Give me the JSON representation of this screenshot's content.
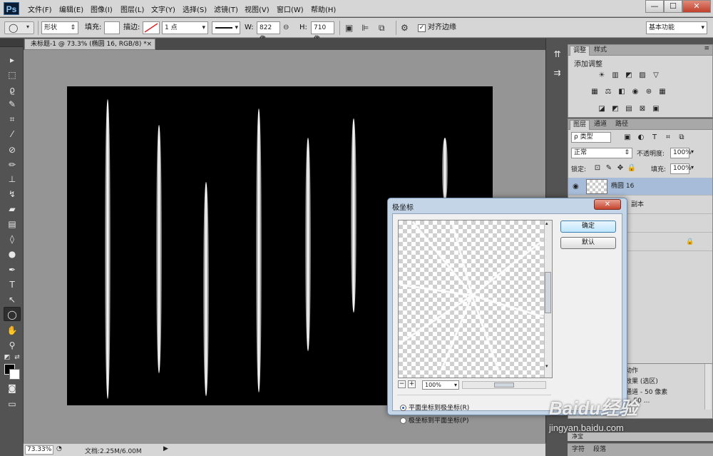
{
  "app": {
    "logo": "Ps",
    "menus": [
      "文件(F)",
      "编辑(E)",
      "图像(I)",
      "图层(L)",
      "文字(Y)",
      "选择(S)",
      "滤镜(T)",
      "视图(V)",
      "窗口(W)",
      "帮助(H)"
    ],
    "window_controls": {
      "minimize": "—",
      "maximize": "☐",
      "close": "✕"
    }
  },
  "options": {
    "mode": "形状",
    "fill_label": "填充:",
    "stroke_label": "描边:",
    "stroke_width": "1 点",
    "w_label": "W:",
    "w_value": "822 像",
    "h_label": "H:",
    "h_value": "710 像",
    "align_edges_label": "对齐边缘",
    "align_edges_checked": true,
    "workspace": "基本功能"
  },
  "document": {
    "tab_title": "未标题-1 @ 73.3% (椭圆 16, RGB/8) *",
    "tab_close": "×"
  },
  "streaks": [
    {
      "center_pct": 9.6,
      "top_pct": 4,
      "bottom_pct": 98
    },
    {
      "center_pct": 21.6,
      "top_pct": 12,
      "bottom_pct": 90
    },
    {
      "center_pct": 32.7,
      "top_pct": 30,
      "bottom_pct": 97
    },
    {
      "center_pct": 45.1,
      "top_pct": 7,
      "bottom_pct": 96
    },
    {
      "center_pct": 56.6,
      "top_pct": 16,
      "bottom_pct": 83
    },
    {
      "center_pct": 67.3,
      "top_pct": 10,
      "bottom_pct": 71
    },
    {
      "center_pct": 88.7,
      "top_pct": 16,
      "bottom_pct": 36
    }
  ],
  "status": {
    "zoom": "73.33%",
    "doc_info": "文档:2.25M/6.00M"
  },
  "panels": {
    "adjustments": {
      "tabs": [
        "调整",
        "样式"
      ],
      "heading": "添加调整",
      "icons_row1": [
        "☀",
        "▥",
        "◩",
        "▨",
        "▽"
      ],
      "icons_row2": [
        "▦",
        "⚖",
        "◧",
        "◉",
        "⊛",
        "▦"
      ],
      "icons_row3": [
        "◪",
        "◩",
        "▤",
        "⊠",
        "▣"
      ]
    },
    "layers": {
      "tabs": [
        "图层",
        "通道",
        "路径"
      ],
      "kind_filter": "ρ 类型",
      "blend_mode": "正常",
      "opacity_label": "不透明度:",
      "opacity_value": "100%",
      "lock_label": "锁定:",
      "fill_label": "填充:",
      "fill_value": "100%",
      "rows": [
        {
          "name": "椭圆 16",
          "selected": true
        },
        {
          "name": "副本",
          "selected": false
        },
        {
          "name": "",
          "selected": false
        },
        {
          "name": "",
          "selected": false
        }
      ]
    },
    "history": {
      "items": [
        "动作",
        "效果 (选区)",
        "通道 - 50 像素",
        "... 50 ..."
      ]
    },
    "bottom_tabs": [
      "字符",
      "段落"
    ],
    "bottom_tab_above": "净宝"
  },
  "dialog": {
    "title": "极坐标",
    "close_label": "✕",
    "ok_label": "确定",
    "default_label": "默认",
    "zoom": "100%",
    "zoom_minus": "−",
    "zoom_plus": "+",
    "option_rect_to_polar": "平面坐标到极坐标(R)",
    "option_polar_to_rect": "极坐标到平面坐标(P)",
    "selected_option": "rect_to_polar"
  },
  "watermark": {
    "logo": "Baidu经验",
    "url": "jingyan.baidu.com"
  }
}
